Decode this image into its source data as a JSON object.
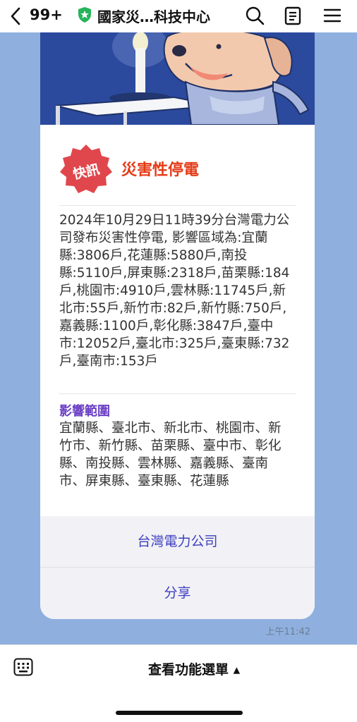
{
  "header": {
    "back_count": "99+",
    "title": "國家災…科技中心",
    "icons": [
      "chevron-left-icon",
      "shield-star-icon",
      "search-icon",
      "notes-icon",
      "menu-icon"
    ]
  },
  "message": {
    "badge_text": "快訊",
    "title": "災害性停電",
    "body": "2024年10月29日11時39分台灣電力公司發布災害性停電, 影響區域為:宜蘭縣:3806戶,花蓮縣:5880戶,南投縣:5110戶,屏東縣:2318戶,苗栗縣:184戶,桃園市:4910戶,雲林縣:11745戶,新北市:55戶,新竹市:82戶,新竹縣:750戶,嘉義縣:1100戶,彰化縣:3847戶,臺中市:12052戶,臺北市:325戶,臺東縣:732戶,臺南市:153戶",
    "scope_label": "影響範圍",
    "scope_text": "宜蘭縣、臺北市、新北市、桃園市、新竹市、新竹縣、苗栗縣、臺中市、彰化縣、南投縣、雲林縣、嘉義縣、臺南市、屏東縣、臺東縣、花蓮縣",
    "actions": [
      "台灣電力公司",
      "分享"
    ],
    "timestamp": "上午11:42"
  },
  "footer": {
    "menu_label": "查看功能選單 ▴",
    "icons": [
      "keyboard-icon"
    ]
  },
  "colors": {
    "chat_background": "#8fb0de",
    "alert_title": "#e43b16",
    "badge": "#e0474c",
    "scope_label": "#6b3fc4",
    "action_text": "#3d3fbf",
    "banner": "#2b4a9e",
    "shield": "#27b45a"
  }
}
